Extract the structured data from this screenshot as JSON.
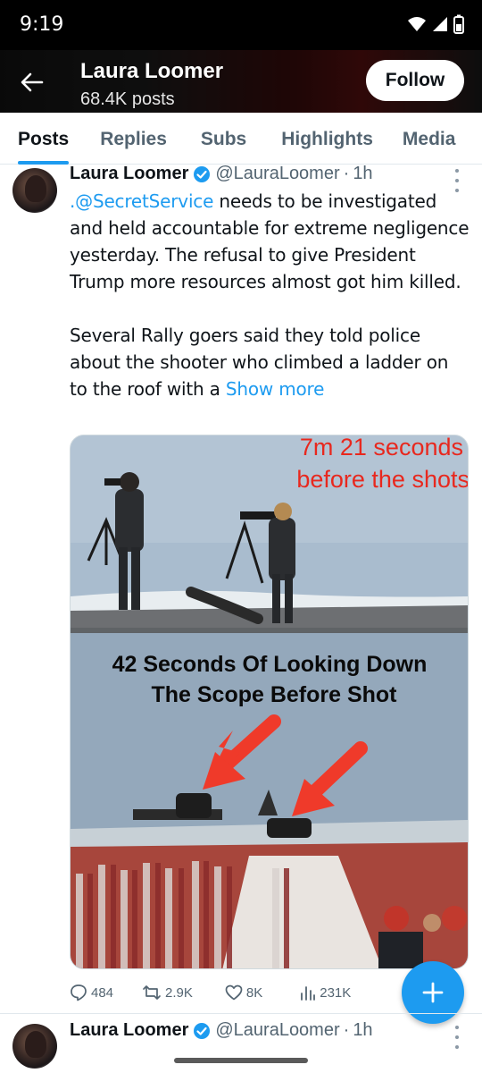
{
  "status_bar": {
    "time": "9:19"
  },
  "header": {
    "name": "Laura Loomer",
    "posts_count": "68.4K posts",
    "follow_label": "Follow"
  },
  "tabs": [
    {
      "label": "Posts",
      "active": true
    },
    {
      "label": "Replies",
      "active": false
    },
    {
      "label": "Subs",
      "active": false
    },
    {
      "label": "Highlights",
      "active": false
    },
    {
      "label": "Media",
      "active": false
    }
  ],
  "tweets": [
    {
      "author": "Laura Loomer",
      "handle": "@LauraLoomer",
      "separator": "·",
      "time": "1h",
      "mention": ".@SecretService",
      "text_after_mention": " needs to be investigated and held accountable for extreme negligence yesterday. The refusal to give President Trump more resources almost got him killed.",
      "paragraph2": "Several Rally goers said they told police about the shooter who climbed a ladder on to the roof with a ",
      "show_more": "Show more",
      "media": {
        "top_caption_line1": "7m 21 seconds",
        "top_caption_line2": "before the shots",
        "bottom_caption_line1": "42 Seconds Of Looking Down",
        "bottom_caption_line2": "The Scope Before Shot"
      },
      "stats": {
        "replies": "484",
        "reposts": "2.9K",
        "likes": "8K",
        "views": "231K"
      }
    },
    {
      "author": "Laura Loomer",
      "handle": "@LauraLoomer",
      "separator": "·",
      "time": "1h"
    }
  ],
  "colors": {
    "accent": "#1d9bf0",
    "caption_red": "#e8281e",
    "text_primary": "#0f1419",
    "text_secondary": "#536471"
  }
}
